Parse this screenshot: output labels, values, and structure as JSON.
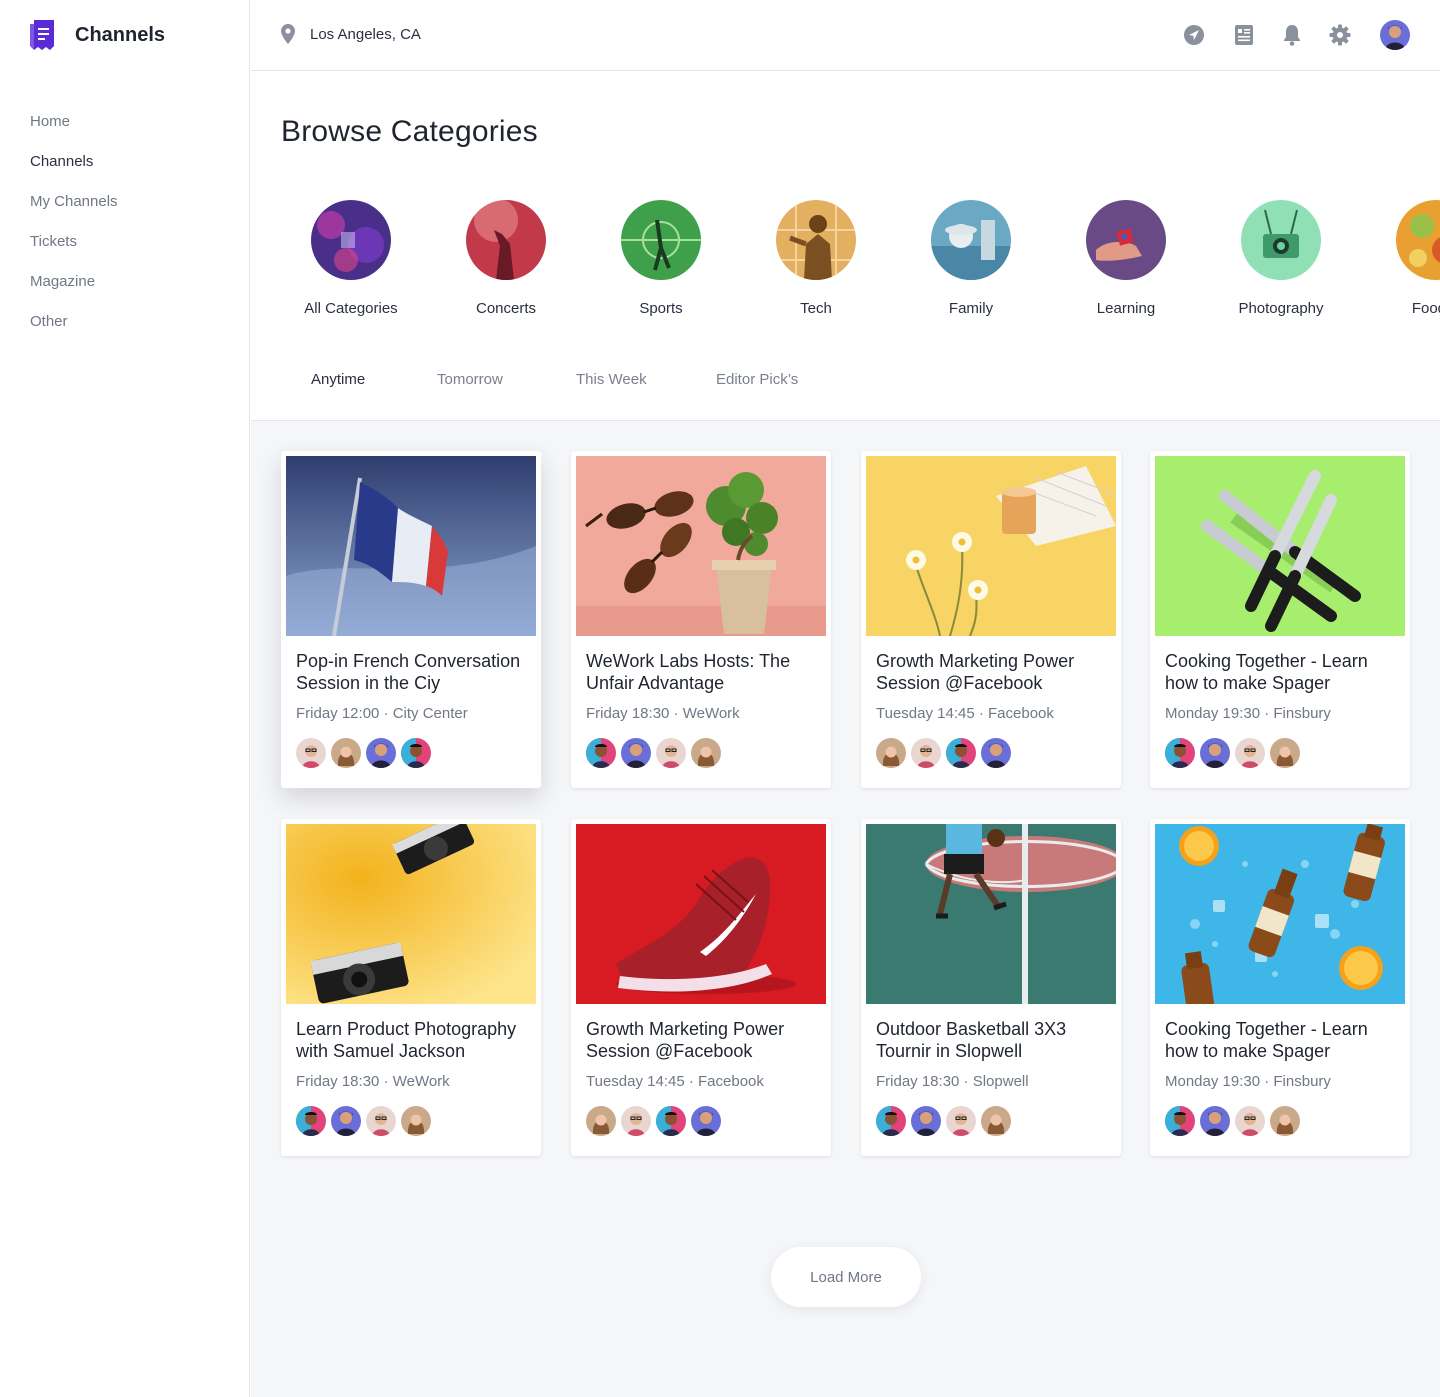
{
  "brand": {
    "name": "Channels",
    "logo_icon": "receipt-logo-icon",
    "accent": "#5b2bd6"
  },
  "sidebar": {
    "items": [
      {
        "label": "Home"
      },
      {
        "label": "Channels"
      },
      {
        "label": "My Channels"
      },
      {
        "label": "Tickets"
      },
      {
        "label": "Magazine"
      },
      {
        "label": "Other"
      }
    ],
    "active": "Channels"
  },
  "topbar": {
    "location": "Los Angeles, CA",
    "icons": [
      "location-pin-icon",
      "navigation-icon",
      "newspaper-icon",
      "bell-icon",
      "gear-icon",
      "user-avatar"
    ]
  },
  "page": {
    "title": "Browse Categories"
  },
  "categories": [
    {
      "label": "All Categories"
    },
    {
      "label": "Concerts"
    },
    {
      "label": "Sports"
    },
    {
      "label": "Tech"
    },
    {
      "label": "Family"
    },
    {
      "label": "Learning"
    },
    {
      "label": "Photography"
    },
    {
      "label": "Food &"
    }
  ],
  "tabs": [
    {
      "label": "Anytime"
    },
    {
      "label": "Tomorrow"
    },
    {
      "label": "This Week"
    },
    {
      "label": "Editor Pick’s"
    }
  ],
  "active_tab": "Anytime",
  "events": [
    {
      "title": "Pop-in French Conversation Session in the Ciy",
      "meta": "Friday 12:00 · City Center"
    },
    {
      "title": "WeWork Labs Hosts: The Unfair Advantage",
      "meta": "Friday 18:30 · WeWork"
    },
    {
      "title": "Growth Marketing Power Session @Facebook",
      "meta": "Tuesday 14:45 · Facebook"
    },
    {
      "title": "Cooking Together - Learn how to make Spager",
      "meta": "Monday 19:30 · Finsbury"
    },
    {
      "title": "Learn Product Photography with Samuel Jackson",
      "meta": "Friday 18:30 · WeWork"
    },
    {
      "title": "Growth Marketing Power Session @Facebook",
      "meta": "Tuesday 14:45 · Facebook"
    },
    {
      "title": "Outdoor Basketball 3X3 Tournir in Slopwell",
      "meta": "Friday 18:30 · Slopwell"
    },
    {
      "title": "Cooking Together - Learn how to make Spager",
      "meta": "Monday 19:30 · Finsbury"
    }
  ],
  "load_more": "Load More"
}
